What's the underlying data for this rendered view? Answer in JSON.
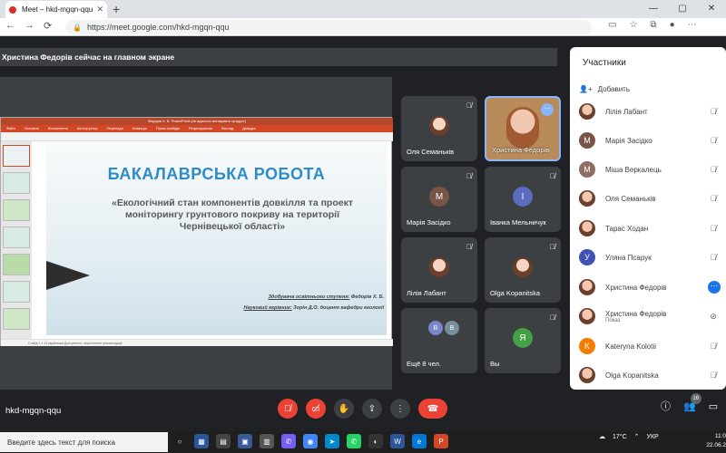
{
  "browser": {
    "tab_title": "Meet – hkd-mgqn-qqu",
    "url": "https://meet.google.com/hkd-mgqn-qqu",
    "new_tab": "+",
    "win_min": "—",
    "win_max": "▢",
    "win_close": "✕"
  },
  "banner": "Христина Федорів сейчас на главном экране",
  "slide": {
    "window_title": "Федорів Х. Б.   PowerPoint (не вдалося активувати продукт)",
    "ribbon": [
      "Файл",
      "Основне",
      "Вставлення",
      "Конструктор",
      "Переходи",
      "Анімація",
      "Показ слайдів",
      "Рецензування",
      "Вигляд",
      "Довідка"
    ],
    "heading": "БАКАЛАВРСЬКА РОБОТА",
    "body": "«Екологічний стан компонентів довкілля та проект моніторингу грунтового покриву на території Чернівецької області»",
    "student_label": "Здобувача освітнього ступеня:",
    "student_name": "Федорів Х. Б.",
    "supervisor_label": "Науковий керівник:",
    "supervisor_name": "Зорін Д.О. доцент кафедри екології",
    "status": "Слайд 1 з 14   українська   Доступність: перегляньте рекомендації"
  },
  "tiles": [
    {
      "name": "Оля Семанькiв"
    },
    {
      "name": "Христина Федорів"
    },
    {
      "name": "Марія Засідко",
      "initial": "М"
    },
    {
      "name": "Іванка Мельничук",
      "initial": "I"
    },
    {
      "name": "Лілія Лабант"
    },
    {
      "name": "Olga Kopanitska"
    },
    {
      "name": "Ещё 8 чел.",
      "minis": [
        "В",
        "В"
      ]
    },
    {
      "name": "Вы",
      "initial": "Я"
    }
  ],
  "panel": {
    "title": "Участники",
    "add": "Добавить",
    "people": [
      {
        "name": "Лілія Лабант"
      },
      {
        "name": "Марія Засідко",
        "initial": "М"
      },
      {
        "name": "Міша Веркалець",
        "initial": "М"
      },
      {
        "name": "Оля Семаньків"
      },
      {
        "name": "Тарас Ходан"
      },
      {
        "name": "Уляна Псарук",
        "initial": "У"
      },
      {
        "name": "Христина Федорів"
      },
      {
        "name": "Христина Федорів",
        "sub": "Показ"
      },
      {
        "name": "Kateryna Kolotii",
        "initial": "K"
      },
      {
        "name": "Olga Kopanitska"
      }
    ]
  },
  "bottom": {
    "meeting_code": "hkd-mgqn-qqu",
    "participants_count": "16"
  },
  "taskbar": {
    "search": "Введите здесь текст для поиска",
    "temperature": "17°C",
    "lang": "УКР",
    "time": "11:0",
    "date": "22.06.2"
  },
  "colors": {
    "accent": "#1a73e8",
    "end_call": "#ea4335",
    "bg": "#202124"
  }
}
